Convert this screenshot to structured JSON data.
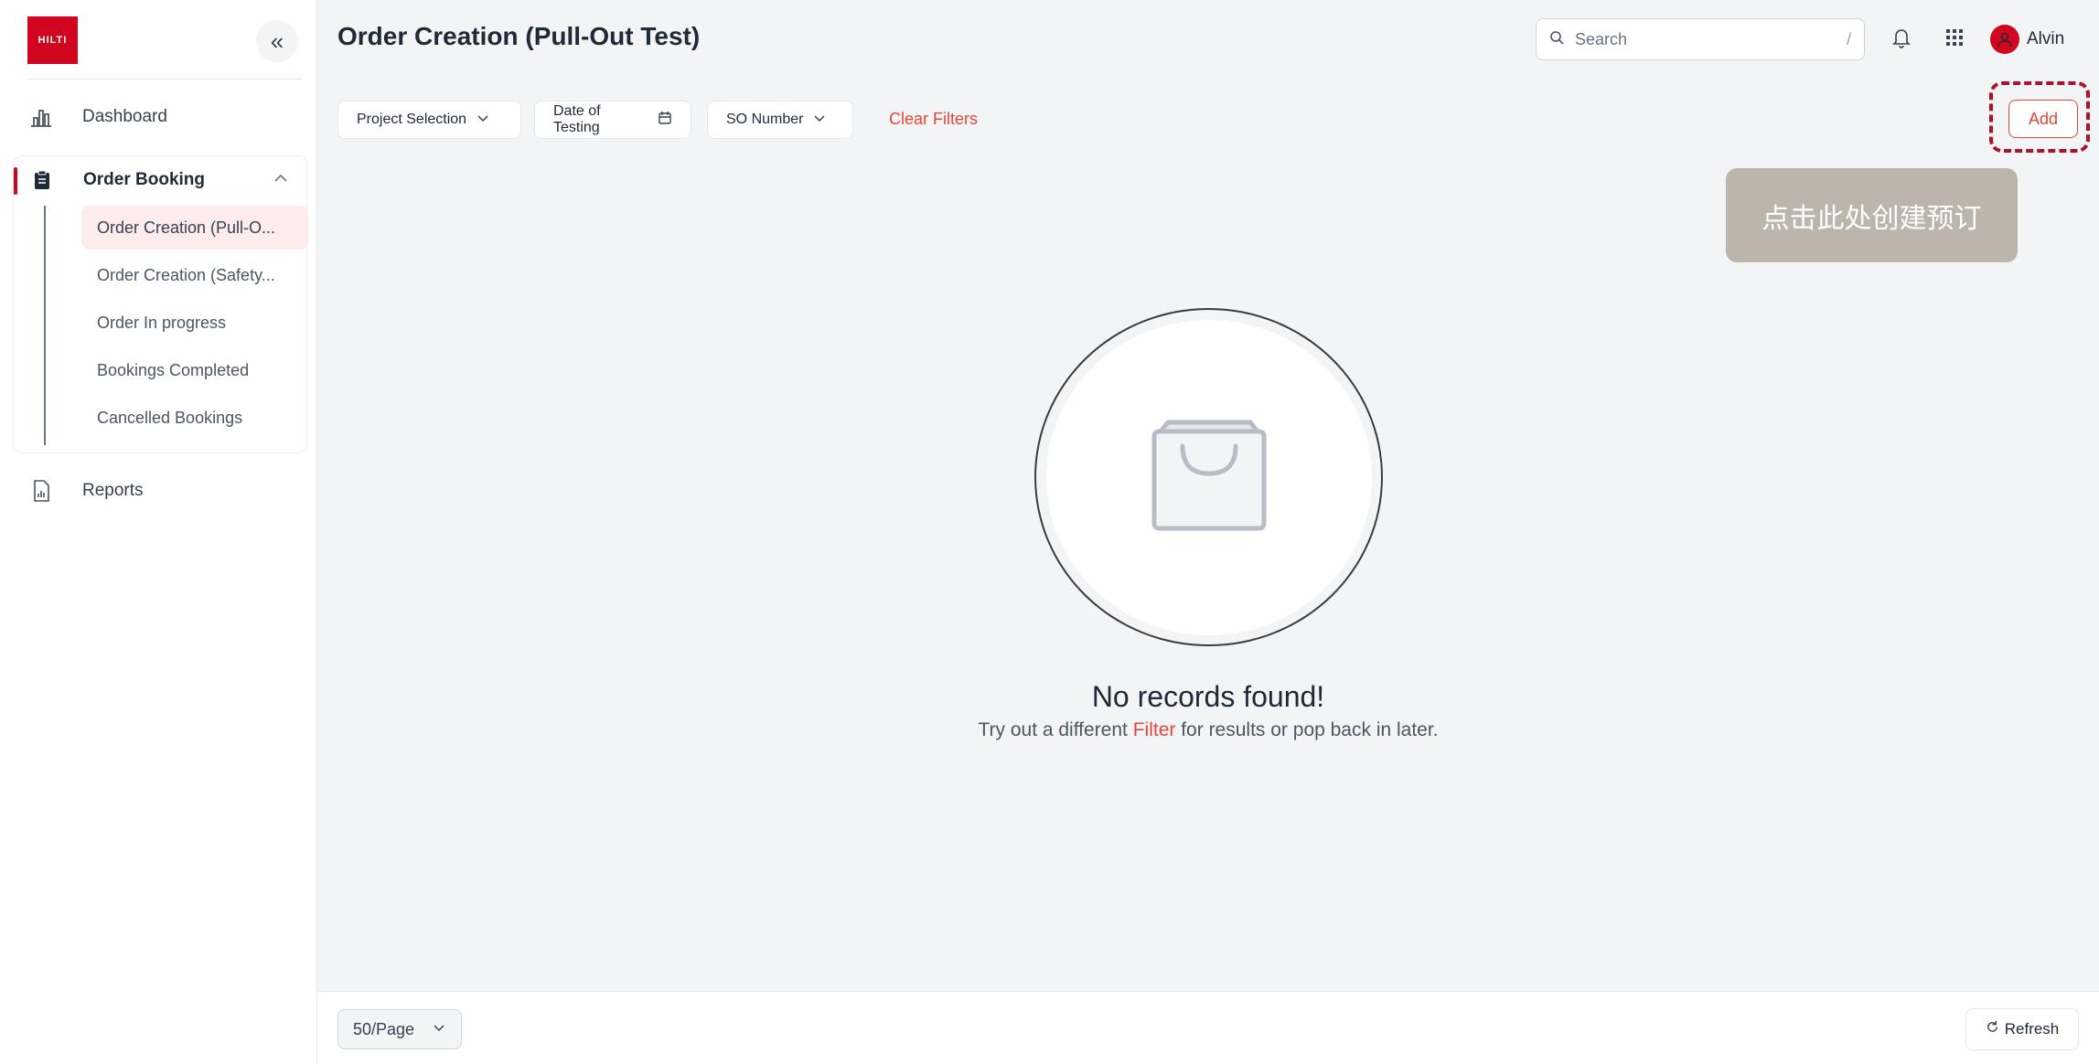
{
  "sidebar": {
    "logo_text": "HILTI",
    "items": [
      {
        "label": "Dashboard"
      },
      {
        "label": "Order Booking"
      },
      {
        "label": "Reports"
      }
    ],
    "sub_items": [
      {
        "label": "Order Creation (Pull-O..."
      },
      {
        "label": "Order Creation (Safety..."
      },
      {
        "label": "Order In progress"
      },
      {
        "label": "Bookings Completed"
      },
      {
        "label": "Cancelled Bookings"
      }
    ]
  },
  "header": {
    "title": "Order Creation (Pull-Out Test)",
    "search_placeholder": "Search",
    "search_shortcut": "/",
    "user_name": "Alvin"
  },
  "filters": {
    "project_selection": "Project Selection",
    "date_of_testing": "Date of Testing",
    "so_number": "SO Number",
    "clear": "Clear Filters"
  },
  "actions": {
    "add_label": "Add",
    "tooltip": "点击此处创建预订"
  },
  "empty_state": {
    "title": "No records found!",
    "sub_before": "Try out a different ",
    "sub_link": "Filter",
    "sub_after": " for results or pop back in later."
  },
  "footer": {
    "per_page": "50/Page",
    "refresh": "Refresh"
  },
  "colors": {
    "brand": "#d2051e",
    "accent": "#e4473a",
    "tooltip_bg": "#bcb5ab"
  }
}
